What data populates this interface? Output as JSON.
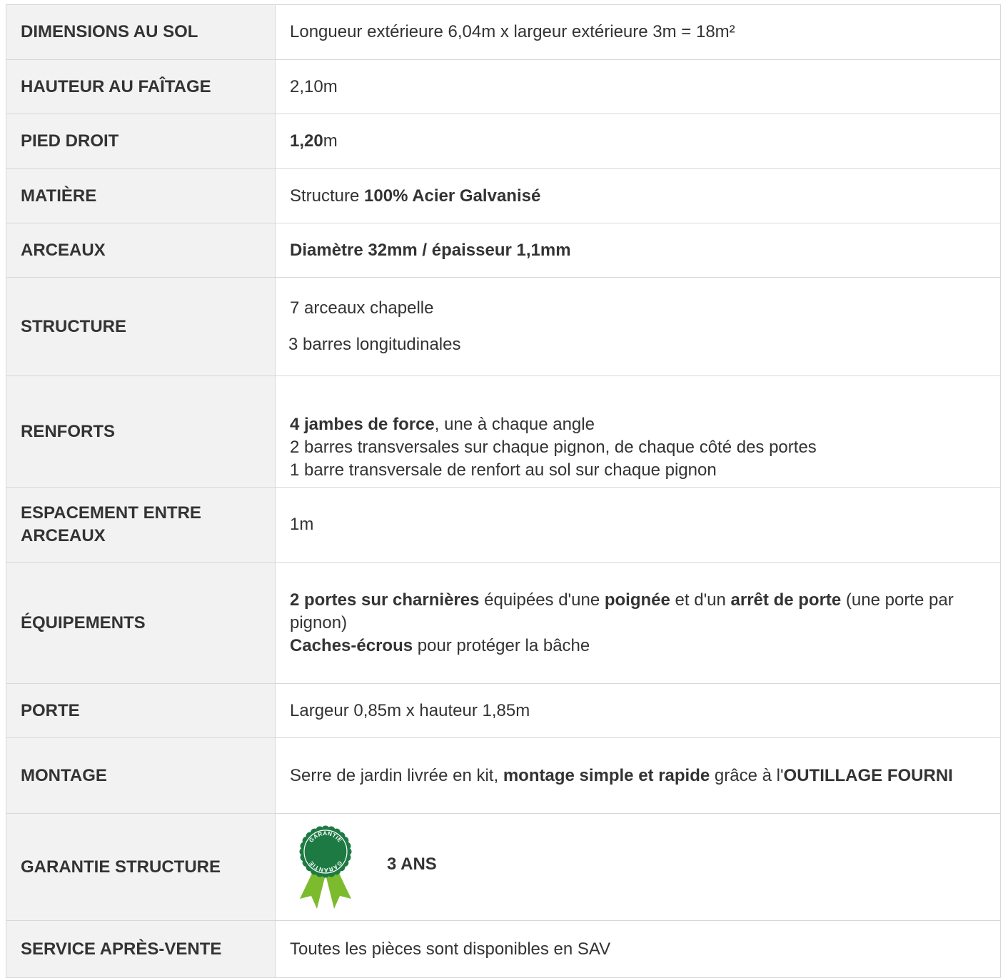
{
  "rows": [
    {
      "label": "DIMENSIONS AU SOL",
      "value": [
        {
          "t": "Longueur extérieure 6,04m x largeur extérieure 3m = 18m²",
          "b": false
        }
      ]
    },
    {
      "label": "HAUTEUR AU FAÎTAGE",
      "value": [
        {
          "t": "2,10m",
          "b": false
        }
      ]
    },
    {
      "label": "PIED DROIT",
      "value": [
        {
          "t": "1,20",
          "b": true
        },
        {
          "t": "m",
          "b": false
        }
      ]
    },
    {
      "label": "MATIÈRE",
      "value": [
        {
          "t": "Structure ",
          "b": false
        },
        {
          "t": "100% Acier Galvanisé",
          "b": true
        }
      ]
    },
    {
      "label": "ARCEAUX",
      "value": [
        {
          "t": "Diamètre 32mm / épaisseur 1,1mm",
          "b": true
        }
      ]
    },
    {
      "label": "STRUCTURE",
      "lines": [
        "7 arceaux chapelle",
        "3 barres longitudinales"
      ]
    },
    {
      "label": "RENFORTS",
      "lines": [
        [
          {
            "t": "4 jambes de force",
            "b": true
          },
          {
            "t": ", une à chaque angle",
            "b": false
          }
        ],
        [
          {
            "t": "2 barres transversales sur chaque pignon, de chaque côté des portes",
            "b": false
          }
        ],
        [
          {
            "t": "1 barre transversale de renfort au sol sur chaque pignon",
            "b": false
          }
        ]
      ]
    },
    {
      "label": "ESPACEMENT ENTRE ARCEAUX",
      "value": [
        {
          "t": "1m",
          "b": false
        }
      ]
    },
    {
      "label": "ÉQUIPEMENTS",
      "lines": [
        [
          {
            "t": "2 portes sur charnières",
            "b": true
          },
          {
            "t": " équipées d'une ",
            "b": false
          },
          {
            "t": "poignée",
            "b": true
          },
          {
            "t": " et d'un ",
            "b": false
          },
          {
            "t": "arrêt de porte",
            "b": true
          },
          {
            "t": " (une porte par pignon)",
            "b": false
          }
        ],
        [
          {
            "t": "Caches-écrous",
            "b": true
          },
          {
            "t": " pour protéger la bâche",
            "b": false
          }
        ]
      ]
    },
    {
      "label": "PORTE",
      "value": [
        {
          "t": "Largeur 0,85m x hauteur 1,85m",
          "b": false
        }
      ]
    },
    {
      "label": "MONTAGE",
      "value": [
        {
          "t": "Serre de jardin livrée en kit, ",
          "b": false
        },
        {
          "t": "montage simple et rapide",
          "b": true
        },
        {
          "t": " grâce à l'",
          "b": false
        },
        {
          "t": "OUTILLAGE FOURNI",
          "b": true
        }
      ]
    },
    {
      "label": "GARANTIE STRUCTURE",
      "badge": {
        "icon": "guarantee-rosette-icon",
        "text_top": "GARANTIE",
        "text_bottom": "GARANTIE",
        "color": "#1e7a43",
        "ribbon_color": "#7dbb2e"
      },
      "value_text": "3 ANS"
    },
    {
      "label": "SERVICE APRÈS-VENTE",
      "value": [
        {
          "t": "Toutes les pièces sont disponibles en SAV",
          "b": false
        }
      ]
    }
  ]
}
